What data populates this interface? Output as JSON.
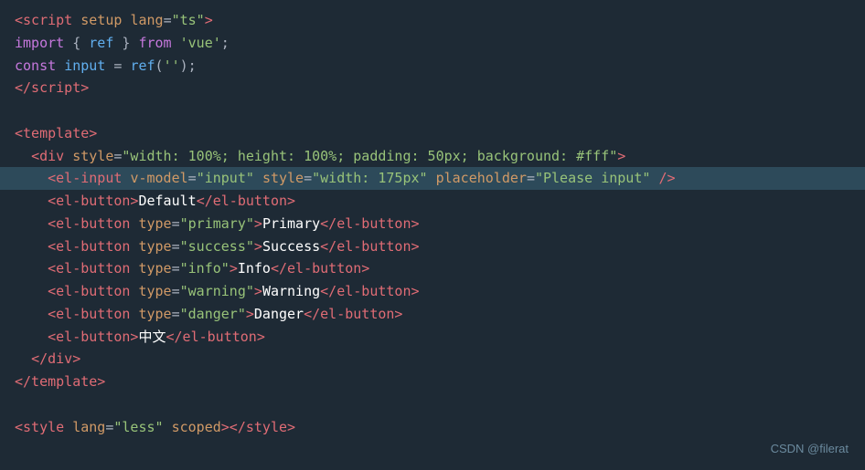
{
  "code": {
    "lines": [
      {
        "id": "l1",
        "highlight": false
      },
      {
        "id": "l2",
        "highlight": false
      },
      {
        "id": "l3",
        "highlight": false
      },
      {
        "id": "l4",
        "highlight": false
      },
      {
        "id": "l5",
        "highlight": false
      },
      {
        "id": "l6",
        "highlight": false
      },
      {
        "id": "l7",
        "highlight": false
      },
      {
        "id": "l8",
        "highlight": true
      },
      {
        "id": "l9",
        "highlight": false
      },
      {
        "id": "l10",
        "highlight": false
      },
      {
        "id": "l11",
        "highlight": false
      },
      {
        "id": "l12",
        "highlight": false
      },
      {
        "id": "l13",
        "highlight": false
      },
      {
        "id": "l14",
        "highlight": false
      },
      {
        "id": "l15",
        "highlight": false
      },
      {
        "id": "l16",
        "highlight": false
      },
      {
        "id": "l17",
        "highlight": false
      },
      {
        "id": "l18",
        "highlight": false
      },
      {
        "id": "l19",
        "highlight": false
      },
      {
        "id": "l20",
        "highlight": false
      }
    ]
  },
  "watermark": {
    "text": "CSDN @filerat"
  }
}
